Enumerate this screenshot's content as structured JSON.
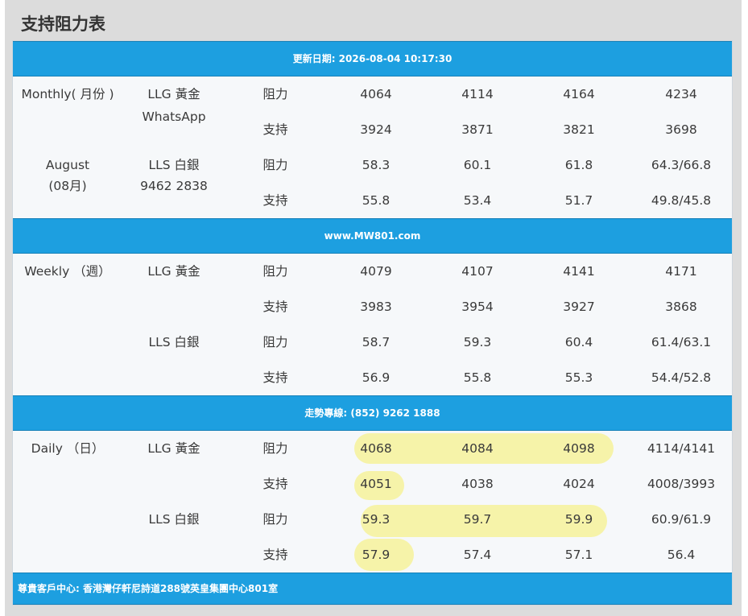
{
  "page_title": "支持阻力表",
  "update_banner": "更新日期: 2026-08-04 10:17:30",
  "website_banner": "www.MW801.com",
  "hotline_banner": "走勢專線: (852) 9262 1888",
  "footer_banner": "尊貴客戶中心: 香港灣仔軒尼詩道288號英皇集團中心801室",
  "highlight_color": "#f6f29a",
  "banner_color": "#1d9fe0",
  "monthly": {
    "period_line1": "Monthly( 月份 )",
    "period_line2": "August",
    "period_line3": "(08月)",
    "gold_label": "LLG 黃金",
    "gold_contact": "WhatsApp",
    "silver_label": "LLS 白銀",
    "silver_contact": "9462 2838",
    "rows": [
      {
        "type": "阻力",
        "v1": "4064",
        "v2": "4114",
        "v3": "4164",
        "v4": "4234"
      },
      {
        "type": "支持",
        "v1": "3924",
        "v2": "3871",
        "v3": "3821",
        "v4": "3698"
      },
      {
        "type": "阻力",
        "v1": "58.3",
        "v2": "60.1",
        "v3": "61.8",
        "v4": "64.3/66.8"
      },
      {
        "type": "支持",
        "v1": "55.8",
        "v2": "53.4",
        "v3": "51.7",
        "v4": "49.8/45.8"
      }
    ]
  },
  "weekly": {
    "period_line1": "Weekly （週）",
    "gold_label": "LLG 黃金",
    "silver_label": "LLS 白銀",
    "rows": [
      {
        "type": "阻力",
        "v1": "4079",
        "v2": "4107",
        "v3": "4141",
        "v4": "4171"
      },
      {
        "type": "支持",
        "v1": "3983",
        "v2": "3954",
        "v3": "3927",
        "v4": "3868"
      },
      {
        "type": "阻力",
        "v1": "58.7",
        "v2": "59.3",
        "v3": "60.4",
        "v4": "61.4/63.1"
      },
      {
        "type": "支持",
        "v1": "56.9",
        "v2": "55.8",
        "v3": "55.3",
        "v4": "54.4/52.8"
      }
    ]
  },
  "daily": {
    "period_line1": "Daily （日）",
    "gold_label": "LLG 黃金",
    "silver_label": "LLS 白銀",
    "rows": [
      {
        "type": "阻力",
        "v1": "4068",
        "v2": "4084",
        "v3": "4098",
        "v4": "4114/4141"
      },
      {
        "type": "支持",
        "v1": "4051",
        "v2": "4038",
        "v3": "4024",
        "v4": "4008/3993"
      },
      {
        "type": "阻力",
        "v1": "59.3",
        "v2": "59.7",
        "v3": "59.9",
        "v4": "60.9/61.9"
      },
      {
        "type": "支持",
        "v1": "57.9",
        "v2": "57.4",
        "v3": "57.1",
        "v4": "56.4"
      }
    ]
  }
}
